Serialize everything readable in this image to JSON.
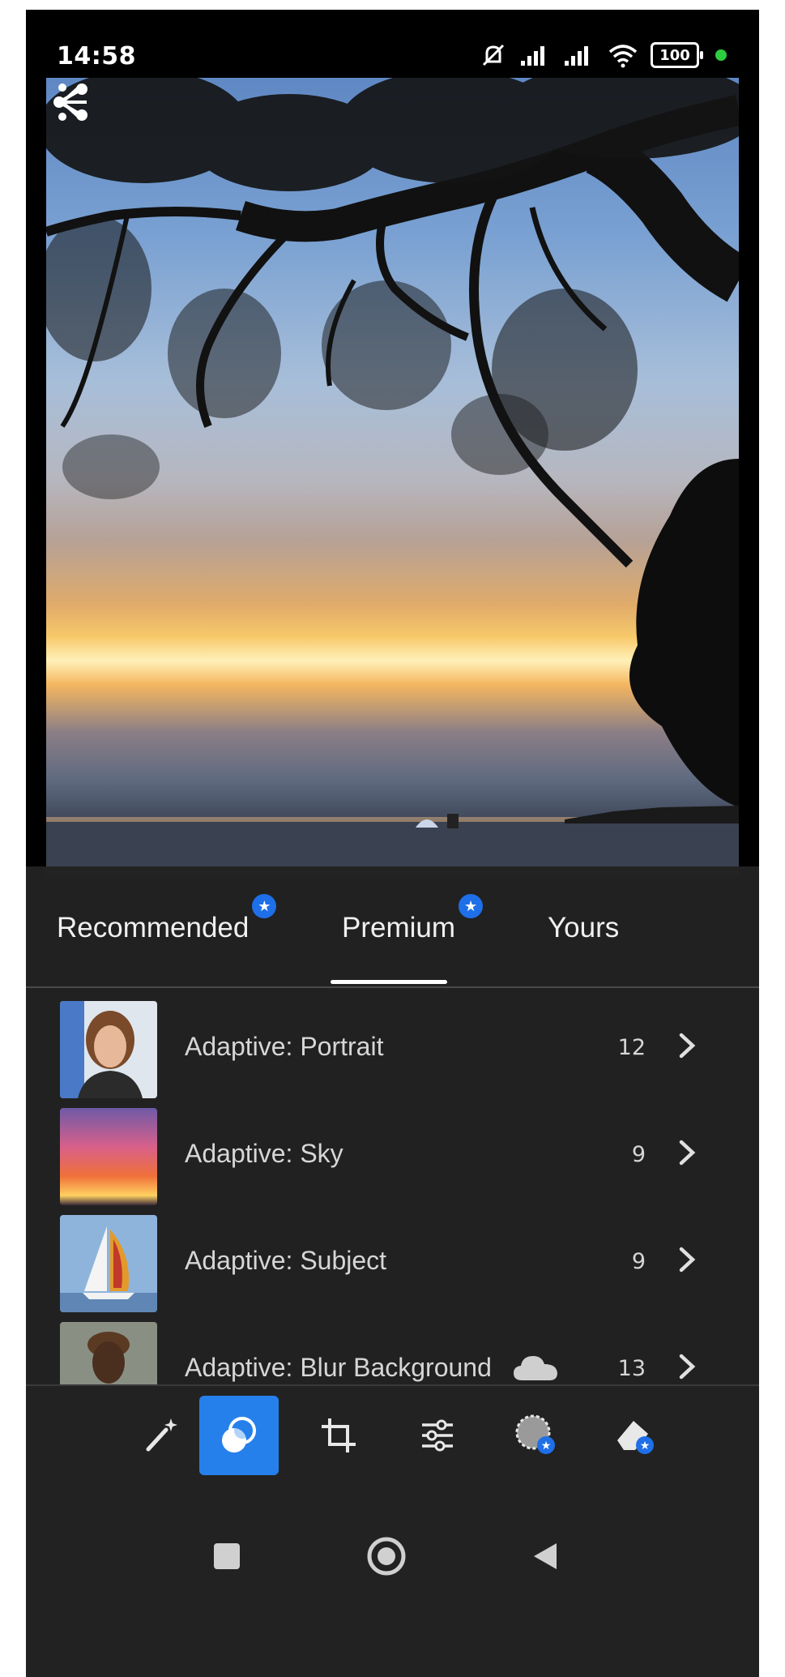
{
  "status": {
    "time": "14:58",
    "battery": "100"
  },
  "tabs": [
    {
      "label": "Recommended",
      "premium": true
    },
    {
      "label": "Premium",
      "premium": true,
      "selected": true
    },
    {
      "label": "Yours",
      "premium": false
    }
  ],
  "presets": [
    {
      "label": "Adaptive: Portrait",
      "count": "12",
      "thumb": "portrait"
    },
    {
      "label": "Adaptive: Sky",
      "count": "9",
      "thumb": "sky"
    },
    {
      "label": "Adaptive: Subject",
      "count": "9",
      "thumb": "sailboat"
    },
    {
      "label": "Adaptive: Blur Background",
      "count": "13",
      "thumb": "man",
      "cloud": true
    }
  ],
  "toolbar": {
    "tools": [
      "auto-wand-icon",
      "presets-icon",
      "crop-icon",
      "adjust-sliders-icon",
      "masking-icon",
      "healing-icon"
    ],
    "active": "presets-icon",
    "accent": "#2680eb",
    "premium_badge_color": "#1e6fe8"
  },
  "navbar": {
    "buttons": [
      "recent-apps-icon",
      "home-icon",
      "back-icon"
    ]
  }
}
